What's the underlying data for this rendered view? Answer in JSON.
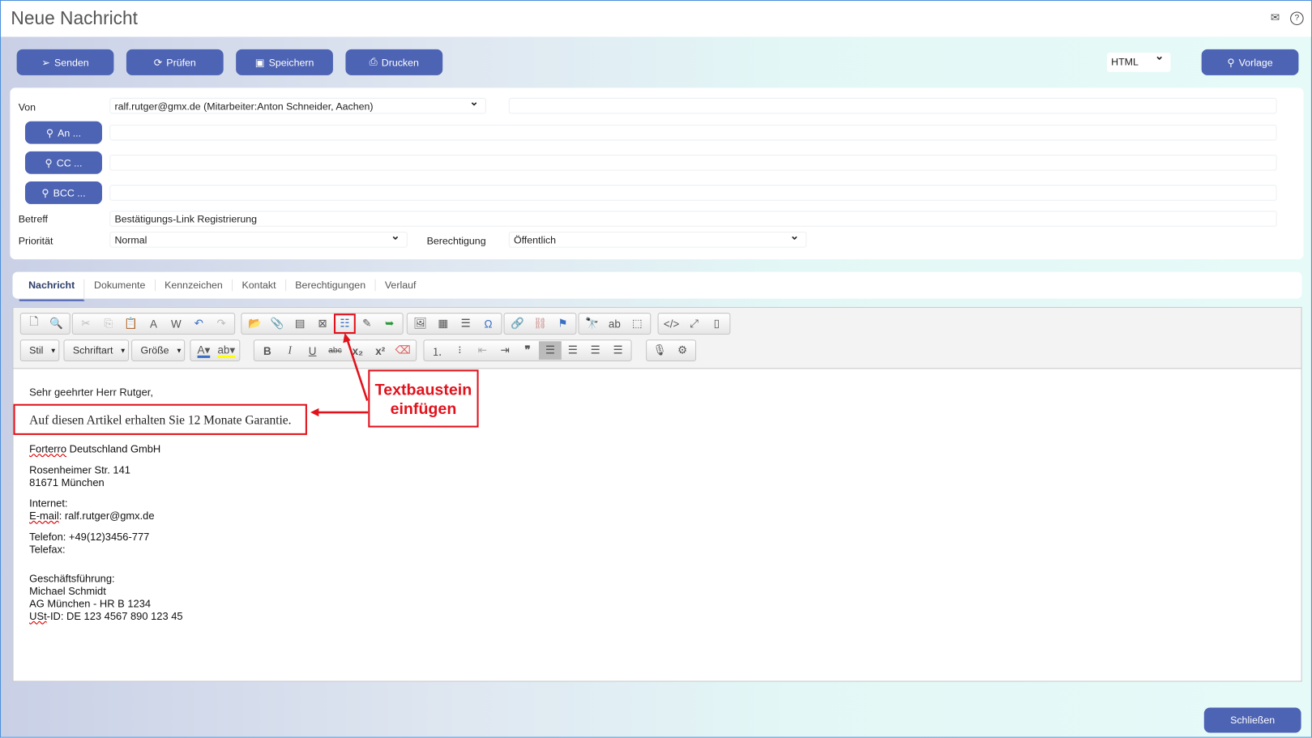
{
  "window": {
    "title": "Neue Nachricht",
    "icons": [
      "mail-icon",
      "help-icon"
    ]
  },
  "toolbar": {
    "send": "Senden",
    "check": "Prüfen",
    "save": "Speichern",
    "print": "Drucken",
    "format": "HTML",
    "template": "Vorlage"
  },
  "form": {
    "from_label": "Von",
    "from_value": "ralf.rutger@gmx.de (Mitarbeiter:Anton Schneider, Aachen)",
    "to_button": "An ...",
    "cc_button": "CC ...",
    "bcc_button": "BCC ...",
    "subject_label": "Betreff",
    "subject_value": "Bestätigungs-Link Registrierung",
    "priority_label": "Priorität",
    "priority_value": "Normal",
    "permission_label": "Berechtigung",
    "permission_value": "Öffentlich"
  },
  "tabs": [
    "Nachricht",
    "Dokumente",
    "Kennzeichen",
    "Kontakt",
    "Berechtigungen",
    "Verlauf"
  ],
  "editor": {
    "style": "Stil",
    "font": "Schriftart",
    "size": "Größe"
  },
  "body": {
    "greeting": "Sehr geehrter Herr Rutger,",
    "inserted": "Auf diesen Artikel erhalten Sie 12 Monate Garantie.",
    "company_a": "Forterro",
    "company_b": " Deutschland GmbH",
    "street": "Rosenheimer Str. 141",
    "city": "81671 München",
    "internet": "Internet:",
    "email_a": "E-mail",
    "email_b": ": ralf.rutger@gmx.de",
    "phone": "Telefon: +49(12)3456-777",
    "fax": "Telefax:",
    "mgmt": "Geschäftsführung:",
    "ceo": "Michael Schmidt",
    "register": "AG München - HR B 1234",
    "vat_a": "USt",
    "vat_b": "-ID: DE 123 4567 890 123 45"
  },
  "annotation": {
    "line1": "Textbaustein",
    "line2": "einfügen",
    "color": "#e1121c"
  },
  "footer": {
    "close": "Schließen"
  }
}
